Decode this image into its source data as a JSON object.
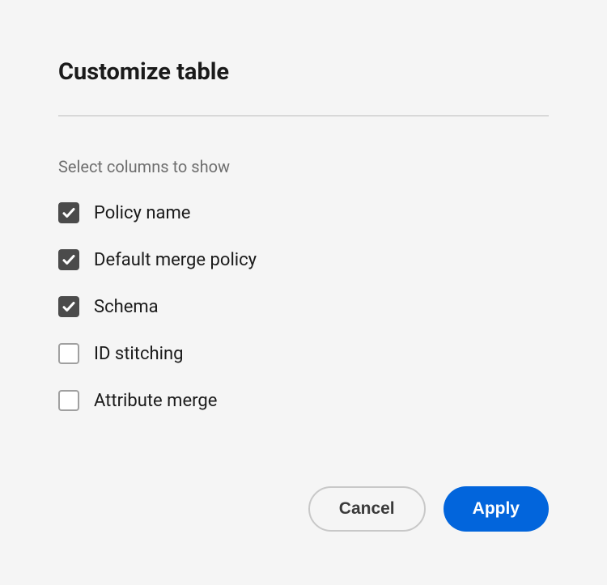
{
  "dialog": {
    "title": "Customize table",
    "section_label": "Select columns to show",
    "columns": [
      {
        "label": "Policy name",
        "checked": true
      },
      {
        "label": "Default merge policy",
        "checked": true
      },
      {
        "label": "Schema",
        "checked": true
      },
      {
        "label": "ID stitching",
        "checked": false
      },
      {
        "label": "Attribute merge",
        "checked": false
      }
    ],
    "buttons": {
      "cancel": "Cancel",
      "apply": "Apply"
    }
  }
}
